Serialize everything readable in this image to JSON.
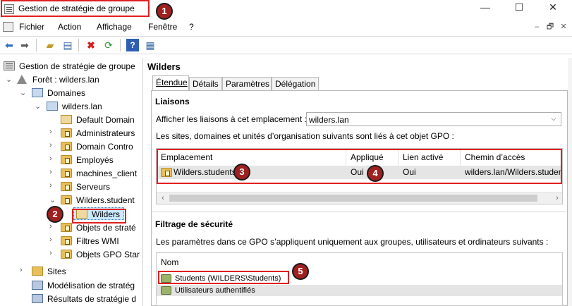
{
  "window": {
    "title": "Gestion de stratégie de groupe",
    "minimize": "—",
    "maximize": "☐",
    "close": "✕"
  },
  "menu": {
    "items": [
      "Fichier",
      "Action",
      "Affichage",
      "Fenêtre",
      "?"
    ],
    "mdi": [
      "–",
      "🗗",
      "✕"
    ]
  },
  "toolbar": {
    "icons": [
      "back-arrow-icon",
      "forward-arrow-icon",
      "up-folder-icon",
      "show-hide-tree-icon",
      "delete-icon",
      "refresh-icon",
      "help-icon",
      "properties-icon"
    ]
  },
  "tree": {
    "root": "Gestion de stratégie de groupe",
    "forest": "Forêt : wilders.lan",
    "domains": "Domaines",
    "domain": "wilders.lan",
    "items": [
      "Default Domain",
      "Administrateurs",
      "Domain Contro",
      "Employés",
      "machines_client",
      "Serveurs",
      "Wilders.student"
    ],
    "selected": "Wilders",
    "after": [
      "Objets de straté",
      "Filtres WMI",
      "Objets GPO Star"
    ],
    "bottom": [
      "Sites",
      "Modélisation de stratég",
      "Résultats de stratégie d"
    ]
  },
  "content": {
    "title": "Wilders",
    "tabs": [
      "Étendue",
      "Détails",
      "Paramètres",
      "Délégation"
    ],
    "links_section": "Liaisons",
    "show_links_label": "Afficher les liaisons à cet emplacement :",
    "location_value": "wilders.lan",
    "linked_desc": "Les sites, domaines et unités d’organisation suivants sont liés à cet objet GPO :",
    "links_table": {
      "headers": [
        "Emplacement",
        "Appliqué",
        "Lien activé",
        "Chemin d’accès"
      ],
      "rows": [
        {
          "location": "Wilders.students",
          "enforced": "Oui",
          "enabled": "Oui",
          "path": "wilders.lan/Wilders.studen"
        }
      ]
    },
    "security_section": "Filtrage de sécurité",
    "security_desc": "Les paramètres dans ce GPO s’appliquent uniquement aux groupes, utilisateurs et ordinateurs suivants :",
    "filter_header": "Nom",
    "filter_rows": [
      "Students (WILDERS\\Students)",
      "Utilisateurs authentifiés"
    ]
  },
  "markers": [
    "1",
    "2",
    "3",
    "4",
    "5"
  ]
}
